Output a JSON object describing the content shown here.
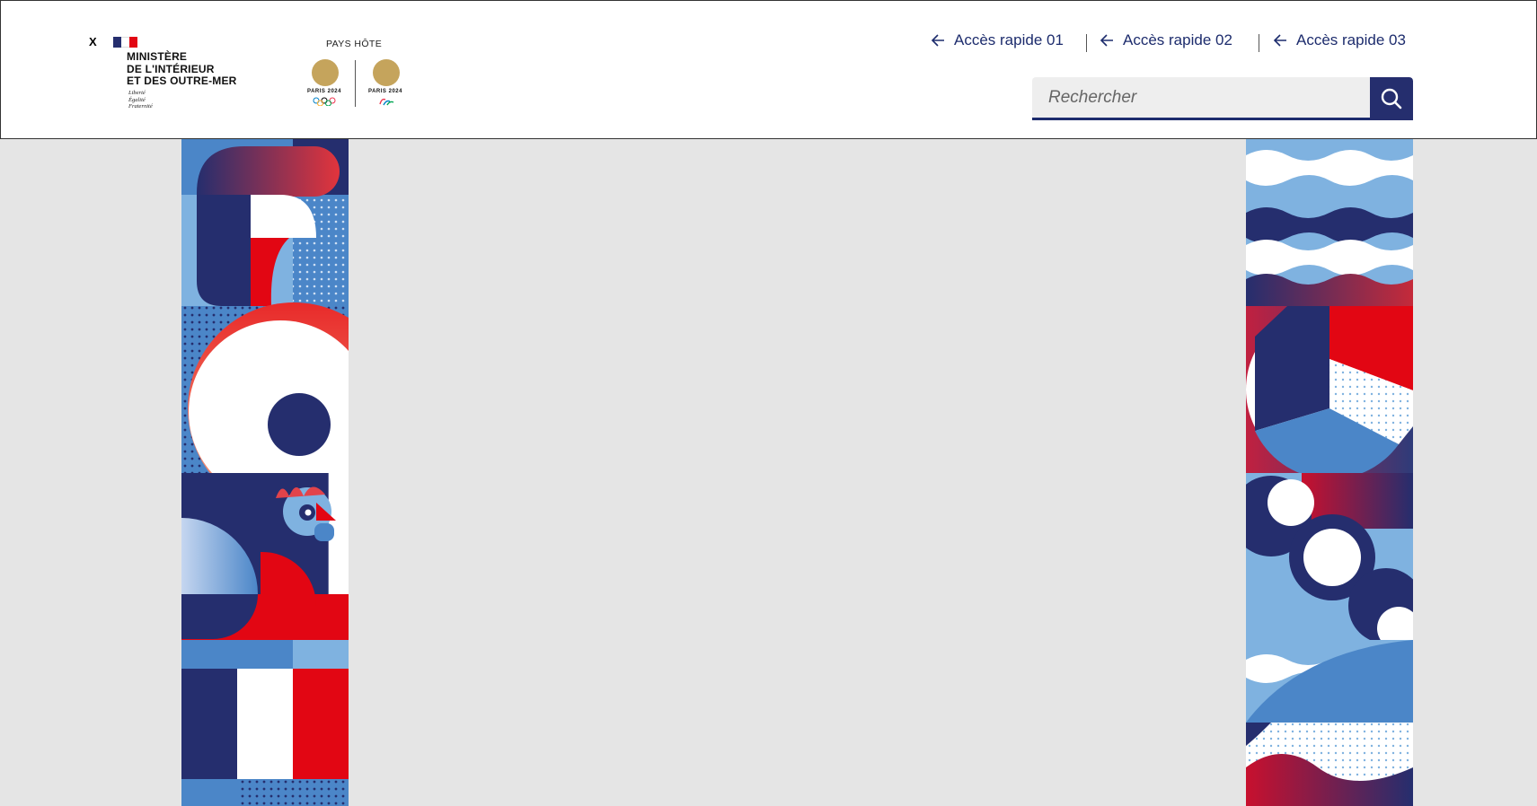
{
  "logo": {
    "prefix": "X",
    "ministry_name": "MINISTÈRE\nDE L'INTÉRIEUR\nET DES OUTRE-MER",
    "motto": "Liberté\nÉgalité\nFraternité"
  },
  "host": {
    "label": "PAYS HÔTE",
    "olympic": "PARIS 2024",
    "paralympic": "PARIS 2024"
  },
  "quick_links": [
    {
      "label": "Accès rapide 01"
    },
    {
      "label": "Accès rapide 02"
    },
    {
      "label": "Accès rapide 03"
    }
  ],
  "search": {
    "placeholder": "Rechercher"
  },
  "colors": {
    "navy": "#252e6e",
    "blue": "#4b86c8",
    "light_blue": "#7fb2e0",
    "red": "#e20613",
    "white": "#ffffff",
    "gold": "#c5a45c",
    "background": "#e5e5e5"
  },
  "icons": [
    "arrow-left-icon",
    "search-icon",
    "flag-icon",
    "olympic-rings-icon",
    "paralympic-agitos-icon",
    "torch-emblem-icon"
  ]
}
